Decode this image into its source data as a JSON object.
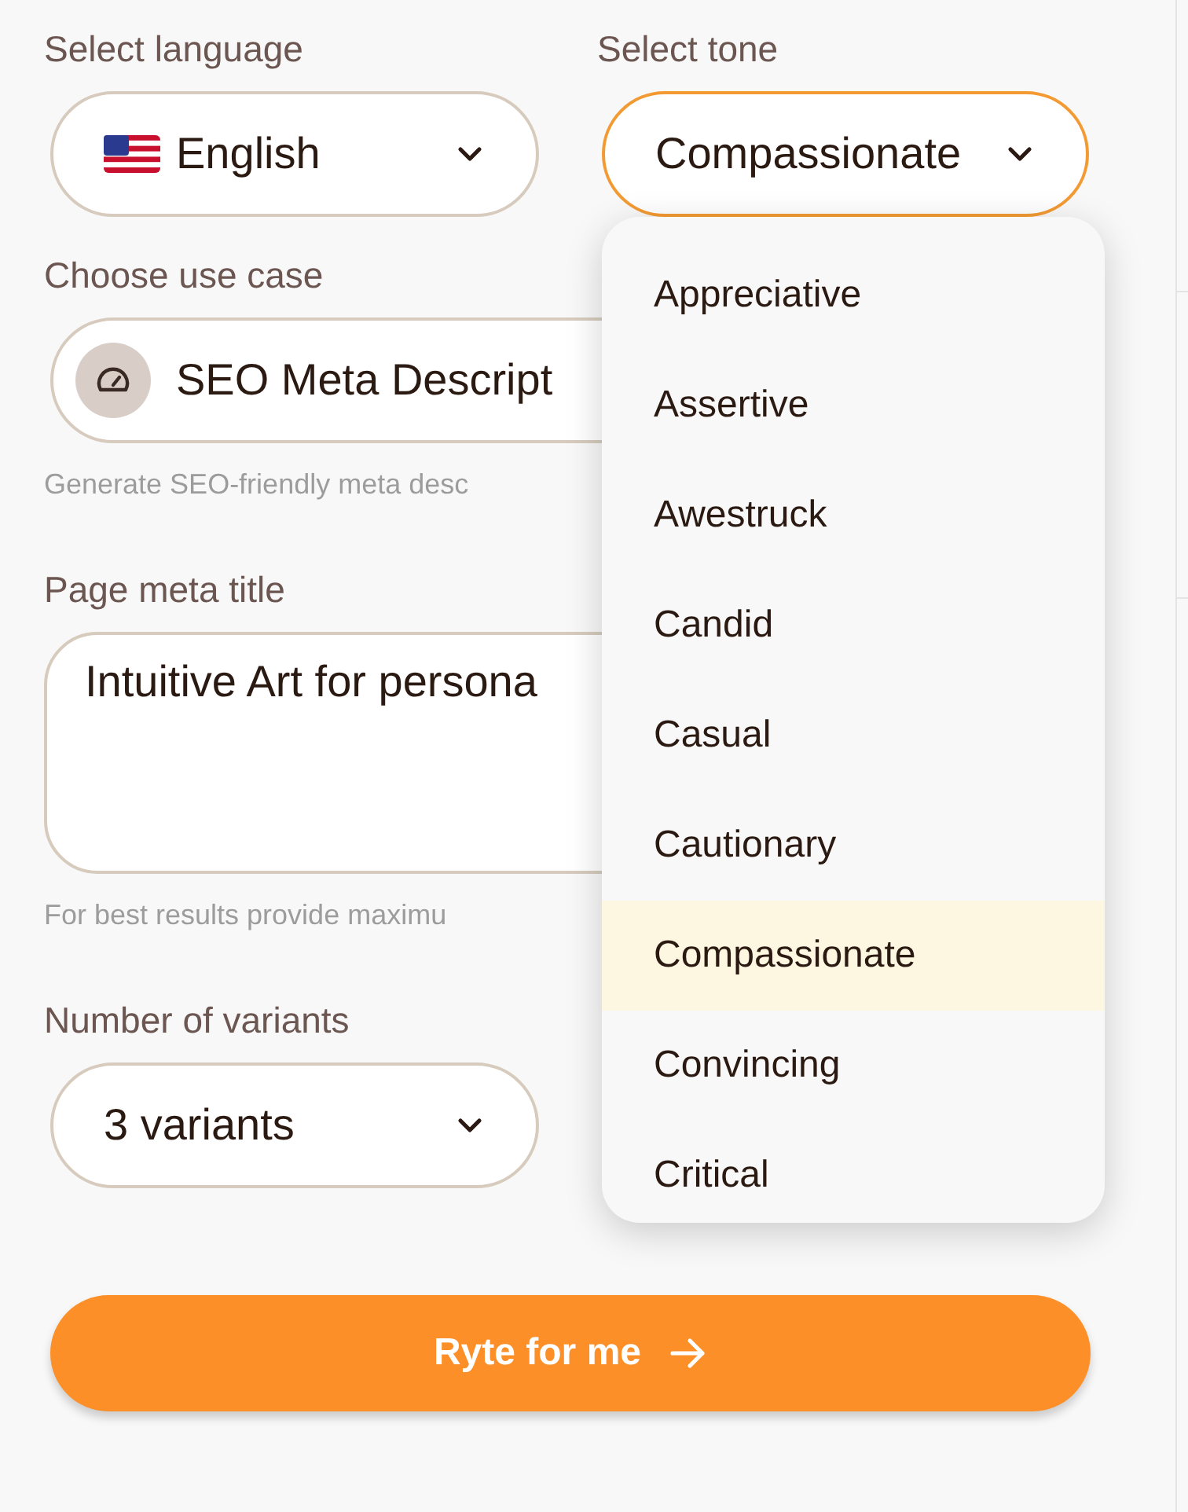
{
  "language": {
    "label": "Select language",
    "value": "English"
  },
  "tone": {
    "label": "Select tone",
    "value": "Compassionate",
    "open": true,
    "options": [
      {
        "label": "Appreciative",
        "selected": false
      },
      {
        "label": "Assertive",
        "selected": false
      },
      {
        "label": "Awestruck",
        "selected": false
      },
      {
        "label": "Candid",
        "selected": false
      },
      {
        "label": "Casual",
        "selected": false
      },
      {
        "label": "Cautionary",
        "selected": false
      },
      {
        "label": "Compassionate",
        "selected": true
      },
      {
        "label": "Convincing",
        "selected": false
      },
      {
        "label": "Critical",
        "selected": false
      }
    ]
  },
  "use_case": {
    "label": "Choose use case",
    "value": "SEO Meta Descript",
    "hint": "Generate SEO-friendly meta desc"
  },
  "meta_title": {
    "label": "Page meta title",
    "value": "Intuitive Art for persona",
    "hint": "For best results provide maximu"
  },
  "variants": {
    "label": "Number of variants",
    "value": "3 variants"
  },
  "submit": {
    "label": "Ryte for me"
  }
}
